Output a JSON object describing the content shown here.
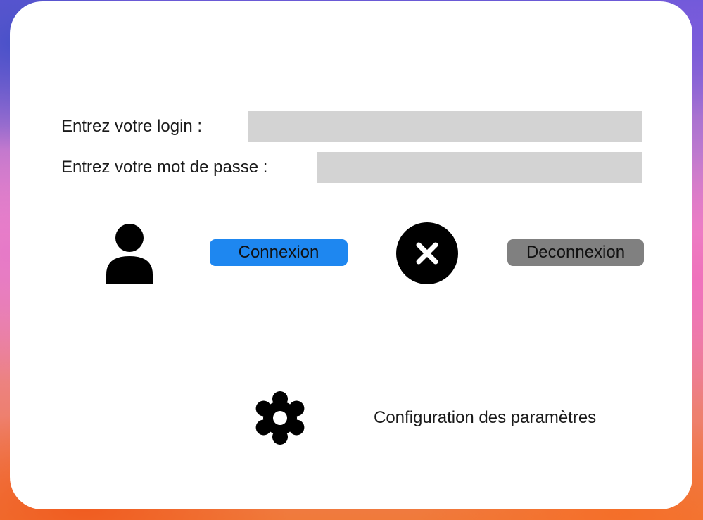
{
  "login": {
    "label": "Entrez votre login :",
    "value": "",
    "placeholder": ""
  },
  "password": {
    "label": "Entrez votre mot de passe :",
    "value": "",
    "placeholder": ""
  },
  "actions": {
    "connect_label": "Connexion",
    "disconnect_label": "Deconnexion",
    "connect_icon": "user-icon",
    "disconnect_icon": "close-circle-icon"
  },
  "settings": {
    "label": "Configuration des paramètres",
    "icon": "gear-icon"
  },
  "colors": {
    "connect_button": "#1e87f0",
    "disconnect_button": "#808080",
    "field_background": "#d3d3d3"
  }
}
